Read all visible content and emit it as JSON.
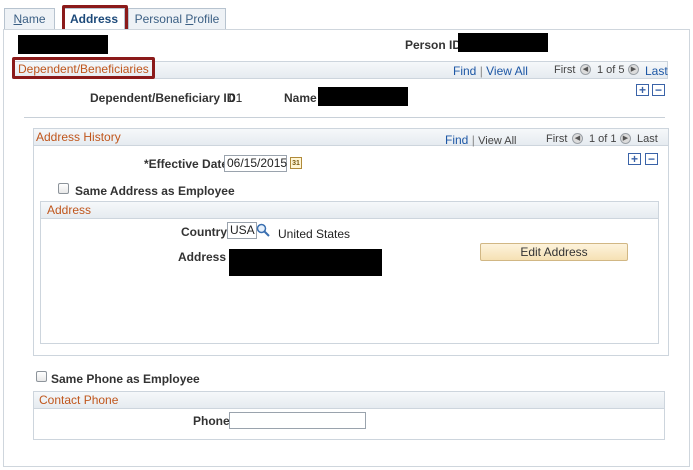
{
  "tabs": [
    {
      "prefix": "",
      "underline": "N",
      "suffix": "ame"
    },
    {
      "prefix": "",
      "underline": "",
      "suffix": "Address"
    },
    {
      "prefix": "Personal ",
      "underline": "P",
      "suffix": "rofile"
    }
  ],
  "header": {
    "person_id_label": "Person ID"
  },
  "dependents": {
    "title": "Dependent/Beneficiaries",
    "find": "Find",
    "view_all": "View All",
    "first": "First",
    "pager": "1 of 5",
    "last": "Last",
    "id_label": "Dependent/Beneficiary ID",
    "id_value": "01",
    "name_label": "Name"
  },
  "address_history": {
    "title": "Address History",
    "find": "Find",
    "view_all": "View All",
    "first": "First",
    "pager": "1 of 1",
    "last": "Last",
    "effective_date_label": "*Effective Date",
    "effective_date_value": "06/15/2015",
    "same_address_label": "Same Address as Employee"
  },
  "address": {
    "title": "Address",
    "country_label": "Country",
    "country_code": "USA",
    "country_name": "United States",
    "address_label": "Address",
    "edit_button": "Edit Address"
  },
  "phone": {
    "same_phone_label": "Same Phone as Employee",
    "contact_title": "Contact Phone",
    "phone_label": "Phone",
    "phone_value": ""
  },
  "icons": {
    "plus": "+",
    "minus": "−",
    "prev": "◀",
    "next": "▶",
    "calendar": "31"
  },
  "colors": {
    "highlight": "#8b1a1a",
    "section_title": "#c0561c",
    "link": "#1d57a5"
  }
}
